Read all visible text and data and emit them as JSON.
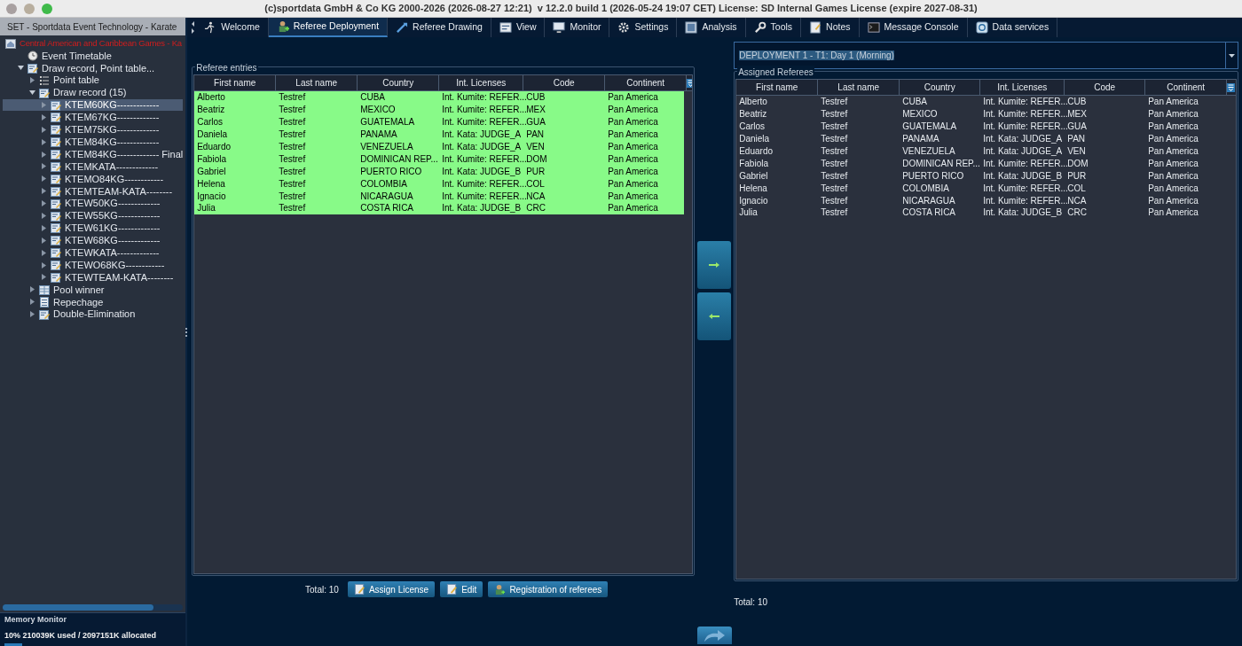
{
  "window": {
    "title": "(c)sportdata GmbH & Co KG 2000-2026 (2026-08-27 12:21)  v 12.2.0 build 1 (2026-05-24 19:07 CET) License: SD Internal Games License (expire 2027-08-31)"
  },
  "sidebar": {
    "title": "SET - Sportdata Event Technology - Karate",
    "event": "Central American and Caribbean Games - Ka",
    "tree": [
      {
        "label": "Event Timetable",
        "kind": "timetable"
      },
      {
        "label": "Draw record, Point table...",
        "kind": "draw",
        "expanded": true,
        "children": [
          {
            "label": "Point table",
            "kind": "points",
            "expanded": false
          },
          {
            "label": "Draw record (15)",
            "kind": "draw",
            "expanded": true,
            "children": [
              {
                "label": "KTEM60KG-------------",
                "kind": "draw",
                "expanded": false,
                "selected": true
              },
              {
                "label": "KTEM67KG-------------",
                "kind": "draw",
                "expanded": false,
                "selected": false
              },
              {
                "label": "KTEM75KG-------------",
                "kind": "draw",
                "expanded": false,
                "selected": false
              },
              {
                "label": "KTEM84KG-------------",
                "kind": "draw",
                "expanded": false,
                "selected": false
              },
              {
                "label": "KTEM84KG------------- Final",
                "kind": "draw",
                "expanded": false,
                "selected": false
              },
              {
                "label": "KTEMKATA-------------",
                "kind": "draw",
                "expanded": false,
                "selected": false
              },
              {
                "label": "KTEMO84KG------------",
                "kind": "draw",
                "expanded": false,
                "selected": false
              },
              {
                "label": "KTEMTEAM-KATA--------",
                "kind": "draw",
                "expanded": false,
                "selected": false
              },
              {
                "label": "KTEW50KG-------------",
                "kind": "draw",
                "expanded": false,
                "selected": false
              },
              {
                "label": "KTEW55KG-------------",
                "kind": "draw",
                "expanded": false,
                "selected": false
              },
              {
                "label": "KTEW61KG-------------",
                "kind": "draw",
                "expanded": false,
                "selected": false
              },
              {
                "label": "KTEW68KG-------------",
                "kind": "draw",
                "expanded": false,
                "selected": false
              },
              {
                "label": "KTEWKATA-------------",
                "kind": "draw",
                "expanded": false,
                "selected": false
              },
              {
                "label": "KTEWO68KG------------",
                "kind": "draw",
                "expanded": false,
                "selected": false
              },
              {
                "label": "KTEWTEAM-KATA--------",
                "kind": "draw",
                "expanded": false,
                "selected": false
              }
            ]
          },
          {
            "label": "Pool winner",
            "kind": "pool",
            "expanded": false
          },
          {
            "label": "Repechage",
            "kind": "repechage",
            "expanded": false
          },
          {
            "label": "Double-Elimination",
            "kind": "draw",
            "expanded": false
          }
        ]
      }
    ]
  },
  "memory_monitor": {
    "title": "Memory Monitor",
    "reading": "10%  210039K used / 2097151K allocated",
    "level": 0.1
  },
  "tabs": [
    {
      "label": "Welcome",
      "selected": false
    },
    {
      "label": "Referee Deployment",
      "selected": true
    },
    {
      "label": "Referee Drawing",
      "selected": false
    },
    {
      "label": "View",
      "selected": false
    },
    {
      "label": "Monitor",
      "selected": false
    },
    {
      "label": "Settings",
      "selected": false
    },
    {
      "label": "Analysis",
      "selected": false
    },
    {
      "label": "Tools",
      "selected": false
    },
    {
      "label": "Notes",
      "selected": false
    },
    {
      "label": "Message Console",
      "selected": false
    },
    {
      "label": "Data services",
      "selected": false
    }
  ],
  "deployment_select": {
    "value": "DEPLOYMENT 1 - T1: Day 1 (Morning)"
  },
  "referee_entries": {
    "title": "Referee entries",
    "columns": [
      "First name",
      "Last name",
      "Country",
      "Int. Licenses",
      "Code",
      "Continent"
    ],
    "rows": [
      [
        "Alberto",
        "Testref",
        "CUBA",
        "Int. Kumite: REFER...",
        "CUB",
        "Pan America"
      ],
      [
        "Beatriz",
        "Testref",
        "MEXICO",
        "Int. Kumite: REFER...",
        "MEX",
        "Pan America"
      ],
      [
        "Carlos",
        "Testref",
        "GUATEMALA",
        "Int. Kumite: REFER...",
        "GUA",
        "Pan America"
      ],
      [
        "Daniela",
        "Testref",
        "PANAMA",
        "Int. Kata: JUDGE_A",
        "PAN",
        "Pan America"
      ],
      [
        "Eduardo",
        "Testref",
        "VENEZUELA",
        "Int. Kata: JUDGE_A",
        "VEN",
        "Pan America"
      ],
      [
        "Fabiola",
        "Testref",
        "DOMINICAN REP...",
        "Int. Kumite: REFER...",
        "DOM",
        "Pan America"
      ],
      [
        "Gabriel",
        "Testref",
        "PUERTO RICO",
        "Int. Kata: JUDGE_B",
        "PUR",
        "Pan America"
      ],
      [
        "Helena",
        "Testref",
        "COLOMBIA",
        "Int. Kumite: REFER...",
        "COL",
        "Pan America"
      ],
      [
        "Ignacio",
        "Testref",
        "NICARAGUA",
        "Int. Kumite: REFER...",
        "NCA",
        "Pan America"
      ],
      [
        "Julia",
        "Testref",
        "COSTA RICA",
        "Int. Kata: JUDGE_B",
        "CRC",
        "Pan America"
      ]
    ],
    "highlighted": true,
    "total": "Total: 10",
    "buttons": [
      "Assign License",
      "Edit",
      "Registration of referees"
    ]
  },
  "assigned_referees": {
    "title": "Assigned Referees",
    "columns": [
      "First name",
      "Last name",
      "Country",
      "Int. Licenses",
      "Code",
      "Continent"
    ],
    "rows": [
      [
        "Alberto",
        "Testref",
        "CUBA",
        "Int. Kumite: REFER...",
        "CUB",
        "Pan America"
      ],
      [
        "Beatriz",
        "Testref",
        "MEXICO",
        "Int. Kumite: REFER...",
        "MEX",
        "Pan America"
      ],
      [
        "Carlos",
        "Testref",
        "GUATEMALA",
        "Int. Kumite: REFER...",
        "GUA",
        "Pan America"
      ],
      [
        "Daniela",
        "Testref",
        "PANAMA",
        "Int. Kata: JUDGE_A",
        "PAN",
        "Pan America"
      ],
      [
        "Eduardo",
        "Testref",
        "VENEZUELA",
        "Int. Kata: JUDGE_A",
        "VEN",
        "Pan America"
      ],
      [
        "Fabiola",
        "Testref",
        "DOMINICAN REP...",
        "Int. Kumite: REFER...",
        "DOM",
        "Pan America"
      ],
      [
        "Gabriel",
        "Testref",
        "PUERTO RICO",
        "Int. Kata: JUDGE_B",
        "PUR",
        "Pan America"
      ],
      [
        "Helena",
        "Testref",
        "COLOMBIA",
        "Int. Kumite: REFER...",
        "COL",
        "Pan America"
      ],
      [
        "Ignacio",
        "Testref",
        "NICARAGUA",
        "Int. Kumite: REFER...",
        "NCA",
        "Pan America"
      ],
      [
        "Julia",
        "Testref",
        "COSTA RICA",
        "Int. Kata: JUDGE_B",
        "CRC",
        "Pan America"
      ]
    ],
    "highlighted": false,
    "total": "Total: 10"
  }
}
